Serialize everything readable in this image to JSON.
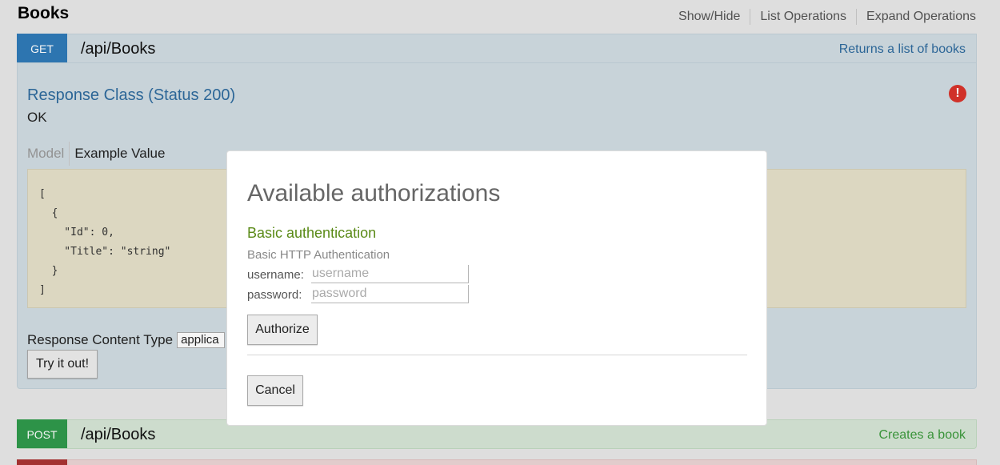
{
  "header": {
    "title": "Books",
    "links": [
      "Show/Hide",
      "List Operations",
      "Expand Operations"
    ]
  },
  "get_operation": {
    "method": "GET",
    "path": "/api/Books",
    "summary": "Returns a list of books",
    "response_class": "Response Class (Status 200)",
    "status_text": "OK",
    "tabs": {
      "model": "Model",
      "example": "Example Value"
    },
    "example_json": "[\n  {\n    \"Id\": 0,\n    \"Title\": \"string\"\n  }\n]",
    "response_content_type_label": "Response Content Type",
    "response_content_type_value": "applica",
    "try_button": "Try it out!",
    "error_icon_glyph": "!"
  },
  "post_operation": {
    "method": "POST",
    "path": "/api/Books",
    "summary": "Creates a book"
  },
  "modal": {
    "title": "Available authorizations",
    "auth_name": "Basic authentication",
    "auth_description": "Basic HTTP Authentication",
    "username_label": "username:",
    "username_placeholder": "username",
    "password_label": "password:",
    "password_placeholder": "password",
    "authorize_button": "Authorize",
    "cancel_button": "Cancel"
  },
  "colors": {
    "get": "#2f7ab8",
    "post": "#2f9a4b",
    "delete": "#aa3333",
    "auth_name": "#5a8a17"
  }
}
